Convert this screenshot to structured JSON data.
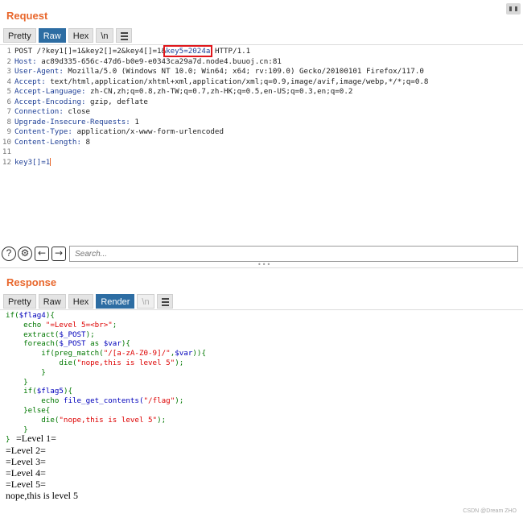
{
  "request": {
    "title": "Request",
    "tabs": [
      {
        "label": "Pretty",
        "state": "normal"
      },
      {
        "label": "Raw",
        "state": "active"
      },
      {
        "label": "Hex",
        "state": "normal"
      },
      {
        "label": "\\n",
        "state": "normal"
      }
    ],
    "lines": [
      {
        "n": "1",
        "parts": [
          {
            "t": "POST /?key1[]=1&key2[]=2&key4[]=1&",
            "c": "hv"
          },
          {
            "t": "key5=2024a",
            "c": "hk"
          },
          {
            "t": " HTTP/1.1",
            "c": "hv"
          }
        ]
      },
      {
        "n": "2",
        "parts": [
          {
            "t": "Host:",
            "c": "hk"
          },
          {
            "t": " ac89d335-656c-47d6-b0e9-e0343ca29a7d.node4.buuoj.cn:81",
            "c": "hv"
          }
        ]
      },
      {
        "n": "3",
        "parts": [
          {
            "t": "User-Agent:",
            "c": "hk"
          },
          {
            "t": " Mozilla/5.0 (Windows NT 10.0; Win64; x64; rv:109.0) Gecko/20100101 Firefox/117.0",
            "c": "hv"
          }
        ]
      },
      {
        "n": "4",
        "parts": [
          {
            "t": "Accept:",
            "c": "hk"
          },
          {
            "t": " text/html,application/xhtml+xml,application/xml;q=0.9,image/avif,image/webp,*/*;q=0.8",
            "c": "hv"
          }
        ]
      },
      {
        "n": "5",
        "parts": [
          {
            "t": "Accept-Language:",
            "c": "hk"
          },
          {
            "t": " zh-CN,zh;q=0.8,zh-TW;q=0.7,zh-HK;q=0.5,en-US;q=0.3,en;q=0.2",
            "c": "hv"
          }
        ]
      },
      {
        "n": "6",
        "parts": [
          {
            "t": "Accept-Encoding:",
            "c": "hk"
          },
          {
            "t": " gzip, deflate",
            "c": "hv"
          }
        ]
      },
      {
        "n": "7",
        "parts": [
          {
            "t": "Connection:",
            "c": "hk"
          },
          {
            "t": " close",
            "c": "hv"
          }
        ]
      },
      {
        "n": "8",
        "parts": [
          {
            "t": "Upgrade-Insecure-Requests:",
            "c": "hk"
          },
          {
            "t": " 1",
            "c": "hv"
          }
        ]
      },
      {
        "n": "9",
        "parts": [
          {
            "t": "Content-Type:",
            "c": "hk"
          },
          {
            "t": " application/x-www-form-urlencoded",
            "c": "hv"
          }
        ]
      },
      {
        "n": "10",
        "parts": [
          {
            "t": "Content-Length:",
            "c": "hk"
          },
          {
            "t": " 8",
            "c": "hv"
          }
        ]
      },
      {
        "n": "11",
        "parts": []
      },
      {
        "n": "12",
        "parts": [
          {
            "t": "key3[]=1",
            "c": "hk"
          }
        ]
      }
    ],
    "search_placeholder": "Search..."
  },
  "response": {
    "title": "Response",
    "tabs": [
      {
        "label": "Pretty",
        "state": "normal"
      },
      {
        "label": "Raw",
        "state": "normal"
      },
      {
        "label": "Hex",
        "state": "normal"
      },
      {
        "label": "Render",
        "state": "active"
      },
      {
        "label": "\\n",
        "state": "disabled"
      }
    ],
    "code_lines": [
      [
        {
          "t": "if(",
          "c": "kw"
        },
        {
          "t": "$flag4",
          "c": "var"
        },
        {
          "t": "){",
          "c": "kw"
        }
      ],
      [
        {
          "t": "    echo ",
          "c": "kw"
        },
        {
          "t": "\"=Level 5=<br>\"",
          "c": "str"
        },
        {
          "t": ";",
          "c": "kw"
        }
      ],
      [
        {
          "t": "    extract(",
          "c": "kw"
        },
        {
          "t": "$_POST",
          "c": "var"
        },
        {
          "t": ");",
          "c": "kw"
        }
      ],
      [
        {
          "t": "    foreach(",
          "c": "kw"
        },
        {
          "t": "$_POST ",
          "c": "var"
        },
        {
          "t": "as ",
          "c": "kw"
        },
        {
          "t": "$var",
          "c": "var"
        },
        {
          "t": "){",
          "c": "kw"
        }
      ],
      [
        {
          "t": "        if(preg_match(",
          "c": "kw"
        },
        {
          "t": "\"/[a-zA-Z0-9]/\"",
          "c": "str"
        },
        {
          "t": ",",
          "c": "kw"
        },
        {
          "t": "$var",
          "c": "var"
        },
        {
          "t": ")){",
          "c": "kw"
        }
      ],
      [
        {
          "t": "            die(",
          "c": "kw"
        },
        {
          "t": "\"nope,this is level 5\"",
          "c": "str"
        },
        {
          "t": ");",
          "c": "kw"
        }
      ],
      [
        {
          "t": "        }",
          "c": "kw"
        }
      ],
      [
        {
          "t": "    }",
          "c": "kw"
        }
      ],
      [
        {
          "t": "    if(",
          "c": "kw"
        },
        {
          "t": "$flag5",
          "c": "var"
        },
        {
          "t": "){",
          "c": "kw"
        }
      ],
      [
        {
          "t": "        echo ",
          "c": "kw"
        },
        {
          "t": "file_get_contents(",
          "c": "var"
        },
        {
          "t": "\"/flag\"",
          "c": "str"
        },
        {
          "t": ");",
          "c": "kw"
        }
      ],
      [
        {
          "t": "    }else{",
          "c": "kw"
        }
      ],
      [
        {
          "t": "        die(",
          "c": "kw"
        },
        {
          "t": "\"nope,this is level 5\"",
          "c": "str"
        },
        {
          "t": ");",
          "c": "kw"
        }
      ],
      [
        {
          "t": "    }",
          "c": "kw"
        }
      ]
    ],
    "closing_brace": "}",
    "output_lines": [
      "=Level 1=",
      "=Level 2=",
      "=Level 3=",
      "=Level 4=",
      "=Level 5=",
      "nope,this is level 5"
    ]
  },
  "watermark": "CSDN @Dream ZHO",
  "colors": {
    "accent": "#e8672c",
    "tab_active": "#2d6da3",
    "highlight": "#e0161b"
  },
  "icons": [
    "help-icon",
    "settings-icon",
    "arrow-left-icon",
    "arrow-right-icon",
    "menu-icon",
    "layout-toggle-icon"
  ]
}
